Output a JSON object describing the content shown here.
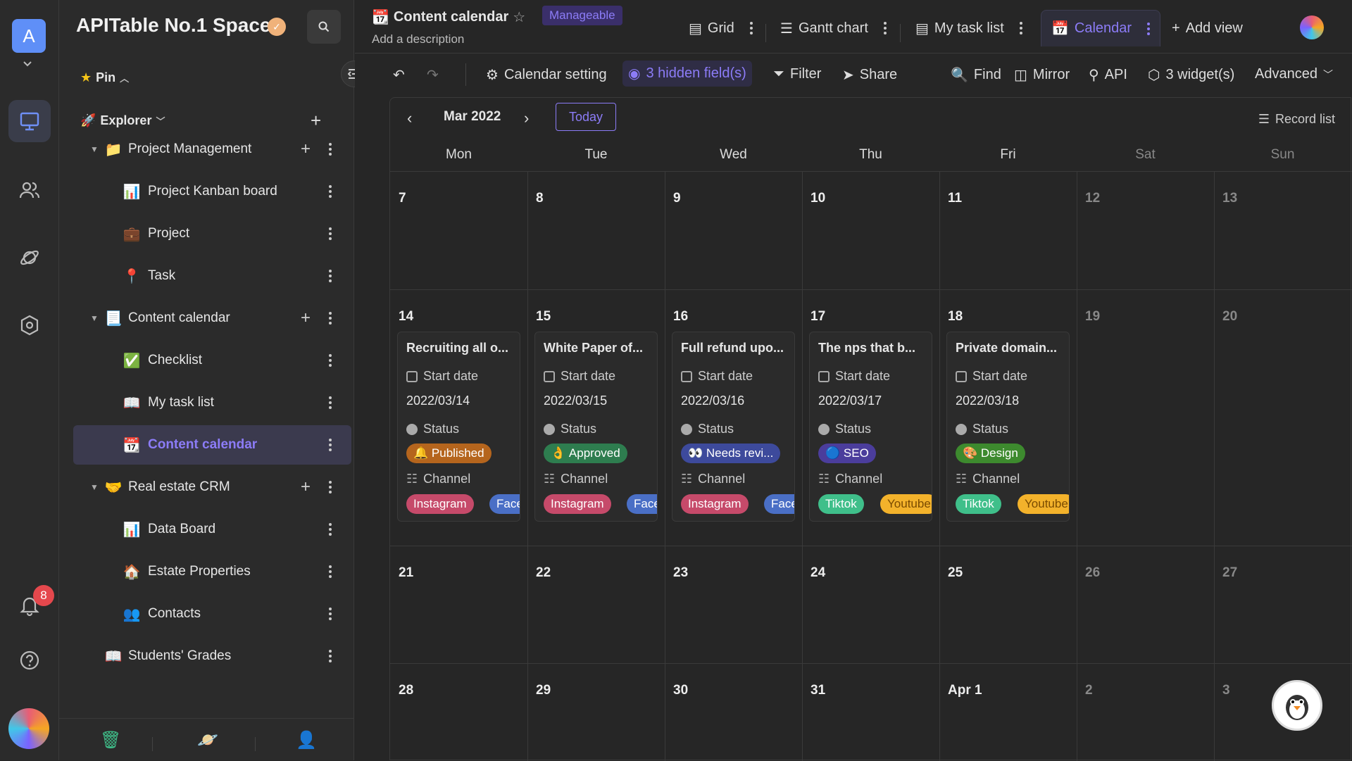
{
  "rail": {
    "avatar_letter": "A",
    "notification_count": "8"
  },
  "sidebar": {
    "space_title": "APITable No.1 Space",
    "pin_label": "Pin",
    "explorer_label": "Explorer",
    "tree": [
      {
        "label": "Project Management",
        "icon": "folder-icon",
        "glyph": "📁",
        "folder": true
      },
      {
        "label": "Project Kanban board",
        "icon": "chart-icon",
        "glyph": "📊"
      },
      {
        "label": "Project",
        "icon": "briefcase-icon",
        "glyph": "💼"
      },
      {
        "label": "Task",
        "icon": "pin-icon",
        "glyph": "📍"
      },
      {
        "label": "Content calendar",
        "icon": "page-icon",
        "glyph": "📃",
        "folder": true
      },
      {
        "label": "Checklist",
        "icon": "check-icon",
        "glyph": "✅"
      },
      {
        "label": "My task list",
        "icon": "book-icon",
        "glyph": "📖"
      },
      {
        "label": "Content calendar",
        "icon": "calendar-icon",
        "glyph": "📆",
        "selected": true
      },
      {
        "label": "Real estate CRM",
        "icon": "handshake-icon",
        "glyph": "🤝",
        "folder": true
      },
      {
        "label": "Data Board",
        "icon": "chart-icon",
        "glyph": "📊"
      },
      {
        "label": "Estate Properties",
        "icon": "house-icon",
        "glyph": "🏠"
      },
      {
        "label": "Contacts",
        "icon": "people-icon",
        "glyph": "👥"
      },
      {
        "label": "Students' Grades",
        "icon": "book-icon",
        "glyph": "📖",
        "folder": true
      }
    ]
  },
  "header": {
    "title": "Content calendar",
    "badge": "Manageable",
    "description": "Add a description",
    "views": {
      "grid": "Grid",
      "gantt": "Gantt chart",
      "tasks": "My task list",
      "calendar": "Calendar",
      "add": "Add view"
    }
  },
  "toolbar": {
    "calendar_setting": "Calendar setting",
    "hidden_fields": "3 hidden field(s)",
    "filter": "Filter",
    "share": "Share",
    "find": "Find",
    "mirror": "Mirror",
    "api": "API",
    "widgets": "3 widget(s)",
    "advanced": "Advanced"
  },
  "calendar": {
    "month": "Mar 2022",
    "today_label": "Today",
    "record_list": "Record list",
    "weekdays": [
      "Mon",
      "Tue",
      "Wed",
      "Thu",
      "Fri",
      "Sat",
      "Sun"
    ],
    "weeks": [
      [
        "7",
        "8",
        "9",
        "10",
        "11",
        "12",
        "13"
      ],
      [
        "14",
        "15",
        "16",
        "17",
        "18",
        "19",
        "20"
      ],
      [
        "21",
        "22",
        "23",
        "24",
        "25",
        "26",
        "27"
      ],
      [
        "28",
        "29",
        "30",
        "31",
        "Apr 1",
        "2",
        "3"
      ]
    ],
    "field_labels": {
      "start": "Start date",
      "status": "Status",
      "channel": "Channel"
    },
    "cards": [
      {
        "title": "Recruiting all o...",
        "date": "2022/03/14",
        "status": "Published",
        "status_glyph": "🔔",
        "status_color": "#b5651d",
        "channels": [
          "Instagram",
          "Face"
        ],
        "channel_colors": [
          "#c64a6a",
          "#4a6fc6"
        ]
      },
      {
        "title": "White Paper of...",
        "date": "2022/03/15",
        "status": "Approved",
        "status_glyph": "👌",
        "status_color": "#2e7d4f",
        "channels": [
          "Instagram",
          "Face"
        ],
        "channel_colors": [
          "#c64a6a",
          "#4a6fc6"
        ]
      },
      {
        "title": "Full refund upo...",
        "date": "2022/03/16",
        "status": "Needs revi...",
        "status_glyph": "👀",
        "status_color": "#3d4a9c",
        "channels": [
          "Instagram",
          "Face"
        ],
        "channel_colors": [
          "#c64a6a",
          "#4a6fc6"
        ]
      },
      {
        "title": "The nps that b...",
        "date": "2022/03/17",
        "status": "SEO",
        "status_glyph": "🔵",
        "status_color": "#4b3d9c",
        "channels": [
          "Tiktok",
          "Youtube"
        ],
        "channel_colors": [
          "#3fbf8a",
          "#f3b22b"
        ]
      },
      {
        "title": "Private domain...",
        "date": "2022/03/18",
        "status": "Design",
        "status_glyph": "🎨",
        "status_color": "#3d8a2e",
        "channels": [
          "Tiktok",
          "Youtube"
        ],
        "channel_colors": [
          "#3fbf8a",
          "#f3b22b"
        ]
      }
    ]
  }
}
